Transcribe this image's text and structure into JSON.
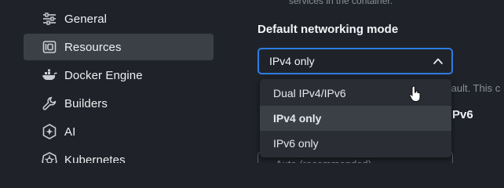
{
  "sidebar": {
    "items": [
      {
        "label": "General",
        "icon": "sliders-icon"
      },
      {
        "label": "Resources",
        "icon": "resources-icon",
        "active": true
      },
      {
        "label": "Docker Engine",
        "icon": "whale-icon"
      },
      {
        "label": "Builders",
        "icon": "wrench-icon"
      },
      {
        "label": "AI",
        "icon": "ai-icon"
      },
      {
        "label": "Kubernetes",
        "icon": "helm-icon"
      }
    ]
  },
  "main": {
    "top_description": "services in the container.",
    "section_title": "Default networking mode",
    "select": {
      "value": "IPv4 only"
    },
    "behind_text_fragment": "fault. This c",
    "behind_heading_fragment": "Pv6",
    "behind_select_value": "Auto (recommended)"
  },
  "dropdown": {
    "options": [
      {
        "label": "Dual IPv4/IPv6",
        "selected": false
      },
      {
        "label": "IPv4 only",
        "selected": true
      },
      {
        "label": "IPv6 only",
        "selected": false
      }
    ]
  },
  "colors": {
    "background": "#1f2329",
    "sidebar_active": "#3b4047",
    "focus_border": "#2e7ce3",
    "menu_background": "#2a2e34"
  }
}
